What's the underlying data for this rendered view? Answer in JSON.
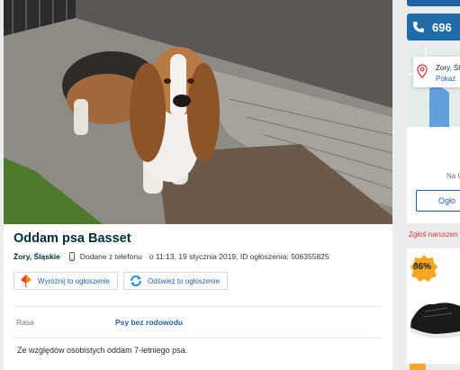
{
  "listing": {
    "title": "Oddam psa Basset",
    "location": "Żory, Śląskie",
    "added_via": "Dodane z telefonu",
    "date_prefix": "o",
    "date": "11:13, 19 stycznia 2019",
    "id_label": "ID ogłoszenia:",
    "id": "506355825",
    "photo_icon": "basset-hound-photo"
  },
  "actions": {
    "highlight_label": "Wyróżnij to ogłoszenie",
    "refresh_label": "Odśwież to ogłoszenie"
  },
  "details": {
    "rasa_label": "Rasa",
    "rasa_value": "Psy bez rodowodu"
  },
  "description": "Ze względów osobistych oddam 7-letniego psa.",
  "sidebar": {
    "phone_partial": "696",
    "map_city": "Żory, Śl",
    "map_show": "Pokaż",
    "na_text": "Na O",
    "ogl_button": "Ogło",
    "report_link": "Zgłoś naruszen",
    "ad_badge": "86%"
  },
  "colors": {
    "link_blue": "#1e62a5",
    "report_red": "#e3343a",
    "badge_orange": "#f5a623"
  }
}
